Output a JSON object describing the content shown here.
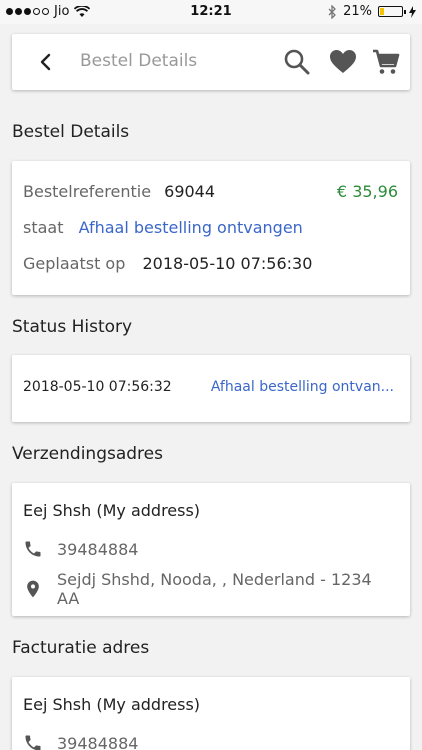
{
  "status_bar": {
    "carrier": "Jio",
    "time": "12:21",
    "battery": "21%",
    "battery_level": 0.21
  },
  "toolbar": {
    "title": "Bestel Details",
    "icons": [
      "back-icon",
      "search-icon",
      "heart-icon",
      "cart-icon"
    ]
  },
  "colors": {
    "blue": "#3a67c9",
    "green": "#2e8b3a"
  },
  "order": {
    "section_title": "Bestel Details",
    "ref_label": "Bestelreferentie",
    "ref_value": "69044",
    "total": "€ 35,96",
    "state_label": "staat",
    "state_value": "Afhaal bestelling ontvangen",
    "placed_label": "Geplaatst op",
    "placed_value": "2018-05-10 07:56:30"
  },
  "history": {
    "section_title": "Status History",
    "entries": [
      {
        "date": "2018-05-10 07:56:32",
        "status": "Afhaal bestelling ontvan..."
      }
    ]
  },
  "shipping": {
    "section_title": "Verzendingsadres",
    "name": "Eej Shsh (My address)",
    "phone": "39484884",
    "address_line1": "Sejdj Shshd, Nooda, , Nederland - 1234",
    "address_line2": "AA"
  },
  "billing": {
    "section_title": "Facturatie adres",
    "name": "Eej Shsh (My address)",
    "phone": "39484884"
  }
}
